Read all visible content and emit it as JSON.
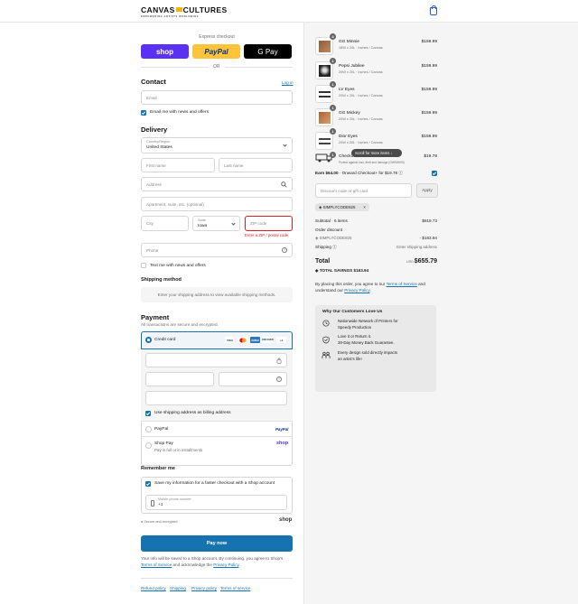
{
  "header": {
    "logo_text_left": "CANVAS",
    "logo_text_right": "CULTURES",
    "logo_tagline": "EMPOWERING ARTISTS WORLDWIDE",
    "bag_icon": "shopping-bag-icon"
  },
  "express": {
    "title": "Express checkout",
    "shop_label": "shop",
    "paypal_label": "PayPal",
    "gpay_label": "G Pay",
    "or_label": "OR"
  },
  "contact": {
    "title": "Contact",
    "login_link": "Log in",
    "email_placeholder": "Email",
    "newsletter_label": "Email me with news and offers",
    "newsletter_checked": true
  },
  "delivery": {
    "title": "Delivery",
    "country_label": "Country/Region",
    "country_value": "United States",
    "first_name_placeholder": "First name",
    "last_name_placeholder": "Last name",
    "address_placeholder": "Address",
    "apartment_placeholder": "Apartment, suite, etc. (optional)",
    "city_placeholder": "City",
    "state_label": "State",
    "state_value": "Iowa",
    "zip_placeholder": "ZIP code",
    "zip_error": "Enter a ZIP / postal code",
    "phone_placeholder": "Phone",
    "sms_label": "Text me with news and offers",
    "sms_checked": false
  },
  "shipping": {
    "title": "Shipping method",
    "message": "Enter your shipping address to view available shipping methods."
  },
  "payment": {
    "title": "Payment",
    "subtitle": "All transactions are secure and encrypted.",
    "credit_card_label": "Credit card",
    "card_brands": [
      "VISA",
      "MC",
      "AMEX",
      "DISCOVER",
      "+4"
    ],
    "billing_same_label": "Use shipping address as billing address",
    "billing_same_checked": true,
    "paypal_label": "PayPal",
    "paypal_logo": "PayPal",
    "shoppay_label": "Shop Pay",
    "shoppay_sub": "Pay in full or in installments",
    "shoppay_logo": "shop"
  },
  "remember": {
    "title": "Remember me",
    "save_label": "Save my information for a faster checkout with a Shop account",
    "save_checked": true,
    "phone_label": "Mobile phone number",
    "phone_value": "+1",
    "secure_label": "Secure and encrypted",
    "shop_logo": "shop"
  },
  "pay_now_label": "Pay now",
  "legal": {
    "text_1": "Your info will be saved to a Shop account. By continuing, you agree to Shop's",
    "tos": "Terms of Service",
    "text_2": "and acknowledge the",
    "privacy": "Privacy Policy",
    "text_3": "."
  },
  "footer_links": [
    "Refund policy",
    "Shipping",
    "Privacy policy",
    "Terms of service"
  ],
  "order": {
    "items": [
      {
        "name": "GG Minnie",
        "variant": "18W x 24L · Inches / Canvas",
        "price": "$159.99",
        "qty": "4"
      },
      {
        "name": "Pepsi Jubilee",
        "variant": "20W x 20L · Inches / Canvas",
        "price": "$159.99",
        "qty": "1"
      },
      {
        "name": "LV Eyes",
        "variant": "20W x 20L · Inches / Canvas",
        "price": "$159.99",
        "qty": "1"
      },
      {
        "name": "GG Mickey",
        "variant": "20W x 20L · Inches / Canvas",
        "price": "$159.99",
        "qty": "1"
      },
      {
        "name": "Dior Eyes",
        "variant": "20W x 20L · Inches / Canvas",
        "price": "$159.99",
        "qty": "1"
      },
      {
        "name": "Checkout+",
        "variant": "Protect against loss, theft and damage (GWSWSSI)",
        "price": "$19.78",
        "qty": "1"
      }
    ],
    "scroll_tooltip": "Scroll for more items",
    "earn_bold": "Earn $64.00",
    "earn_rest": "· Onward Checkout+ for $19.78",
    "earn_checked": true,
    "discount_placeholder": "Discount code or gift card",
    "apply_label": "Apply",
    "applied_code": "SIMPLYCODE825",
    "subtotal_label": "Subtotal · 6 items",
    "subtotal_value": "$819.73",
    "order_discount_label": "Order discount",
    "discount_code": "SIMPLYCODE825",
    "discount_value": "- $163.94",
    "shipping_label": "Shipping",
    "shipping_value": "Enter shipping address",
    "total_label": "Total",
    "total_currency": "USD",
    "total_value": "$655.79",
    "savings_label": "TOTAL SAVINGS",
    "savings_value": "$163.94",
    "agree_1": "By placing this order, you agree to our",
    "agree_tos": "Terms of Service",
    "agree_2": "and",
    "agree_3": "understand our",
    "agree_privacy": "Privacy Policy",
    "agree_4": "."
  },
  "trust": {
    "title": "Why Our Customers Love Us",
    "items": [
      {
        "line1": "Nationwide Network of Printers for",
        "line2": "Speedy Production"
      },
      {
        "line1": "Love it or Return it.",
        "line2": "30-Day Money Back Guarantee."
      },
      {
        "line1": "Every design sold directly impacts",
        "line2": "an artist's life!"
      }
    ]
  }
}
